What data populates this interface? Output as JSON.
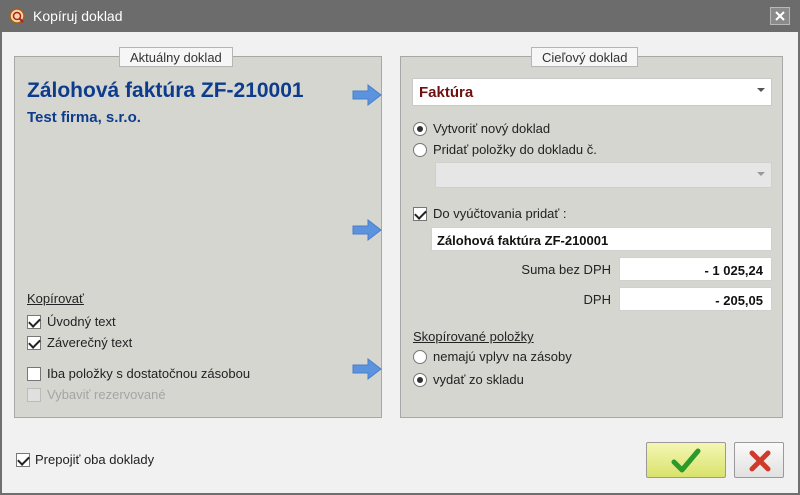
{
  "window": {
    "title": "Kopíruj doklad"
  },
  "source": {
    "tab_label": "Aktuálny doklad",
    "doc_title": "Zálohová faktúra ZF-210001",
    "company": "Test firma, s.r.o.",
    "copy_section_label": "Kopírovať",
    "options": [
      {
        "label": "Úvodný text",
        "checked": true,
        "enabled": true
      },
      {
        "label": "Záverečný text",
        "checked": true,
        "enabled": true
      },
      {
        "label": "Iba položky s dostatočnou zásobou",
        "checked": false,
        "enabled": true
      },
      {
        "label": "Vybaviť rezervované",
        "checked": false,
        "enabled": false
      }
    ]
  },
  "target": {
    "tab_label": "Cieľový doklad",
    "doc_type_selected": "Faktúra",
    "radio_new": "Vytvoriť nový doklad",
    "radio_add": "Pridať položky do dokladu č.",
    "settlement_checkbox_label": "Do vyúčtovania pridať :",
    "settlement_doc": "Zálohová faktúra ZF-210001",
    "sum_label": "Suma bez DPH",
    "sum_value": "- 1 025,24",
    "vat_label": "DPH",
    "vat_value": "-  205,05",
    "copied_items_label": "Skopírované položky",
    "stock_option_1": "nemajú vplyv na zásoby",
    "stock_option_2": "vydať zo skladu"
  },
  "footer": {
    "link_both_label": "Prepojiť oba doklady",
    "link_both_checked": true
  },
  "colors": {
    "title_blue": "#0d3c8c",
    "doc_type_red": "#6e1010",
    "arrow_blue": "#5b93df",
    "ok_green": "#2a9a2a",
    "cancel_red": "#d03a2a"
  }
}
